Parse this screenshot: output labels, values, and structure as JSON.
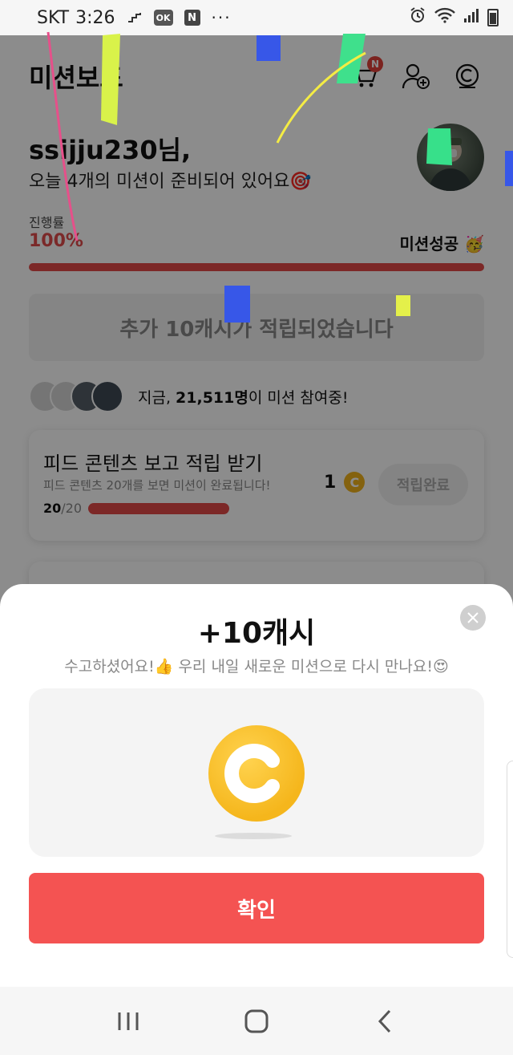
{
  "status_bar": {
    "carrier": "SKT",
    "time": "3:26",
    "ok_badge": "OK",
    "n_badge": "N",
    "more": "···"
  },
  "header": {
    "title": "미션보드",
    "cart_badge": "N"
  },
  "user": {
    "greeting": "ssijju230님,",
    "subtitle": "오늘 4개의 미션이 준비되어 있어요🎯"
  },
  "progress": {
    "label": "진행률",
    "value_text": "100%",
    "fraction": 1.0,
    "status": "미션성공 🥳"
  },
  "reward_banner": "추가 10캐시가 적립되었습니다",
  "participants": {
    "prefix": "지금, ",
    "count": "21,511명",
    "suffix": "이 미션 참여중!"
  },
  "mission_card": {
    "title": "피드 콘텐츠 보고 적립 받기",
    "description": "피드 콘텐츠 20개를 보면 미션이 완료됩니다!",
    "progress_done": "20",
    "progress_total": "/20",
    "progress_fraction": 1.0,
    "reward": "1",
    "coin_symbol": "C",
    "button": "적립완료"
  },
  "sheet": {
    "title": "+10캐시",
    "message": "수고하셨어요!👍 우리 내일 새로운 미션으로 다시 만나요!😍",
    "confirm": "확인"
  },
  "colors": {
    "accent": "#f45352",
    "progress": "#e24a48",
    "coin": "#f5b61c"
  }
}
